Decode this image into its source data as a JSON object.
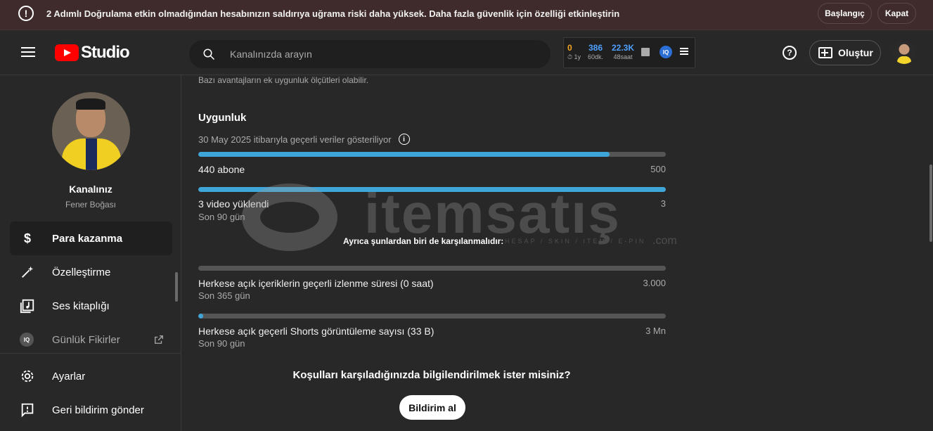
{
  "banner": {
    "icon": "alert-circle-icon",
    "message": "2 Adımlı Doğrulama etkin olmadığından hesabınızın saldırıya uğrama riski daha yüksek. Daha fazla güvenlik için özelliği etkinleştirin",
    "start_label": "Başlangıç",
    "close_label": "Kapat"
  },
  "header": {
    "logo_text": "Studio",
    "search_placeholder": "Kanalınızda arayın",
    "stats": [
      {
        "value": "0",
        "label": "⏱ 1y"
      },
      {
        "value": "386",
        "label": "60dk."
      },
      {
        "value": "22.3K",
        "label": "48saat"
      }
    ],
    "iq_badge": "IQ",
    "create_label": "Oluştur"
  },
  "sidebar": {
    "channel_name": "Kanalınız",
    "channel_handle": "Fener Boğası",
    "items": [
      {
        "label": "Para kazanma",
        "icon": "dollar-icon",
        "active": true
      },
      {
        "label": "Özelleştirme",
        "icon": "magic-wand-icon"
      },
      {
        "label": "Ses kitaplığı",
        "icon": "music-library-icon"
      },
      {
        "label": "Günlük Fikirler",
        "icon": "iq-icon"
      }
    ],
    "bottom_items": [
      {
        "label": "Ayarlar",
        "icon": "gear-icon"
      },
      {
        "label": "Geri bildirim gönder",
        "icon": "feedback-icon"
      }
    ]
  },
  "main": {
    "intro": "Bazı avantajların ek uygunluk ölçütleri olabilir.",
    "section_title": "Uygunluk",
    "data_note": "30 May 2025 itibarıyla geçerli veriler gösteriliyor",
    "requirements": [
      {
        "label": "440 abone",
        "target": "500",
        "sub": "",
        "progress": 0.88
      },
      {
        "label": "3 video yüklendi",
        "target": "3",
        "sub": "Son 90 gün",
        "progress": 1.0
      }
    ],
    "also_label": "Ayrıca şunlardan biri de karşılanmalıdır:",
    "alternatives": [
      {
        "label": "Herkese açık içeriklerin geçerli izlenme süresi (0 saat)",
        "target": "3.000",
        "sub": "Son 365 gün",
        "progress": 0.0
      },
      {
        "label": "Herkese açık geçerli Shorts görüntüleme sayısı (33 B)",
        "target": "3 Mn",
        "sub": "Son 90 gün",
        "progress": 0.011
      }
    ],
    "notify_question": "Koşulları karşıladığınızda bilgilendirilmek ister misiniz?",
    "notify_button": "Bildirim al"
  },
  "watermark": {
    "brand": "itemsatış",
    "tagline": "HESAP / SKIN / ITEM / E-PIN",
    "suffix": ".com"
  }
}
